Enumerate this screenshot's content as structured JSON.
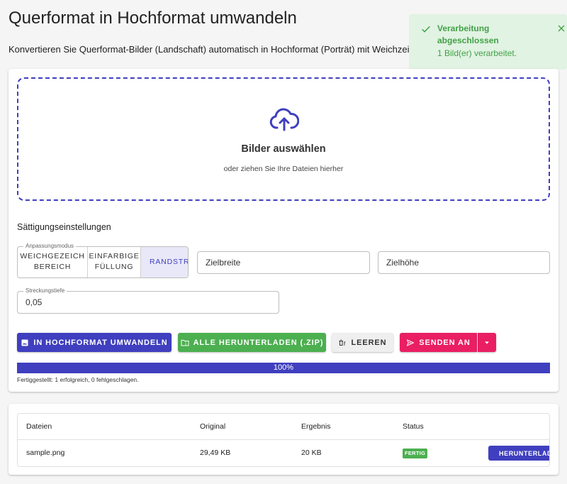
{
  "header": {
    "title": "Querformat in Hochformat umwandeln",
    "description": "Konvertieren Sie Querformat-Bilder (Landschaft) automatisch in Hochformat (Porträt) mit Weichzeich"
  },
  "toast": {
    "title": "Verarbeitung abgeschlossen",
    "message": "1 Bild(er) verarbeitet.",
    "color": "#43a047"
  },
  "dropzone": {
    "title": "Bilder auswählen",
    "subtitle": "oder ziehen Sie Ihre Dateien hierher",
    "icon": "cloud-upload-icon"
  },
  "settings": {
    "section_title": "Sättigungseinstellungen",
    "mode_legend": "Anpassungsmodus",
    "modes": [
      {
        "line1": "WEICHGEZEICH",
        "line2": "BEREICH"
      },
      {
        "line1": "EINFARBIGE",
        "line2": "FÜLLUNG"
      },
      {
        "line1": "RANDSTR",
        "line2": ""
      }
    ],
    "selected_mode": 2,
    "width_placeholder": "Zielbreite",
    "height_placeholder": "Zielhöhe",
    "depth_legend": "Streckungstiefe",
    "depth_value": "0,05"
  },
  "actions": {
    "convert": "IN HOCHFORMAT UMWANDELN",
    "download_zip": "ALLE HERUNTERLADEN (.ZIP)",
    "clear": "LEEREN",
    "send": "SENDEN AN"
  },
  "progress": {
    "label": "100%",
    "value": 1.0,
    "status": "Fertiggestellt: 1 erfolgreich, 0 fehlgeschlagen."
  },
  "table": {
    "headers": [
      "Dateien",
      "Original",
      "Ergebnis",
      "Status"
    ],
    "rows": [
      {
        "file": "sample.png",
        "original": "29,49 KB",
        "result": "20 KB",
        "status": "FERTIG",
        "action": "HERUNTERLADEN"
      }
    ]
  },
  "colors": {
    "primary": "#3f3fbf",
    "success": "#4caf50",
    "accent": "#e91e63"
  }
}
